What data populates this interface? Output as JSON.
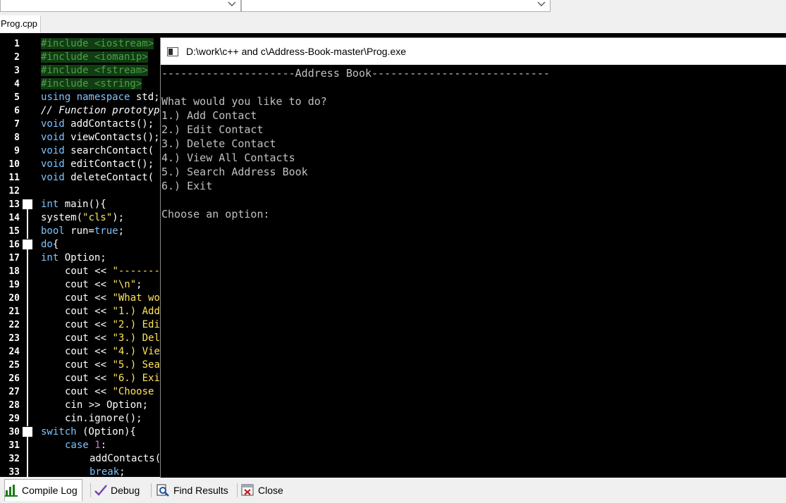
{
  "file_tab": {
    "label": "Prog.cpp"
  },
  "editor": {
    "line_numbers": [
      "1",
      "2",
      "3",
      "4",
      "5",
      "6",
      "7",
      "8",
      "9",
      "10",
      "11",
      "12",
      "13",
      "14",
      "15",
      "16",
      "17",
      "18",
      "19",
      "20",
      "21",
      "22",
      "23",
      "24",
      "25",
      "26",
      "27",
      "28",
      "29",
      "30",
      "31",
      "32",
      "33"
    ],
    "fold_lines": [
      "13",
      "16",
      "30"
    ]
  },
  "code": {
    "l1": "#include <iostream>",
    "l2": "#include <iomanip>",
    "l3": "#include <fstream>",
    "l4": "#include <string>",
    "l5_kw": "using namespace",
    "l5_rest": " std;",
    "l6": "// Function prototyp",
    "l7_kw": "void",
    "l7_rest": " addContacts();",
    "l8_kw": "void",
    "l8_rest": " viewContacts();",
    "l9_kw": "void",
    "l9_rest": " searchContact(",
    "l10_kw": "void",
    "l10_rest": " editContact();",
    "l11_kw": "void",
    "l11_rest": " deleteContact(",
    "l13_kw": "int",
    "l13_rest": " main(){",
    "l14_a": "system(",
    "l14_str": "\"cls\"",
    "l14_b": ");",
    "l15_kw": "bool",
    "l15_rest": " run=",
    "l15_kw2": "true",
    "l15_end": ";",
    "l16_kw": "do",
    "l16_rest": "{",
    "l17_kw": "int",
    "l17_rest": " Option;",
    "cout": "cout << ",
    "l18_str": "\"-------",
    "l19_str": "\"\\n\"",
    "l19_end": ";",
    "l20_str": "\"What wo",
    "l21_str": "\"1.) Add",
    "l22_str": "\"2.) Edi",
    "l23_str": "\"3.) Del",
    "l24_str": "\"4.) Vie",
    "l25_str": "\"5.) Sea",
    "l26_str": "\"6.) Exi",
    "l27_str": "\"Choose ",
    "l28": "cin >> Option;",
    "l29": "cin.ignore();",
    "l30_kw": "switch",
    "l30_rest": " (Option){",
    "l31_kw": "case",
    "l31_num": " 1",
    "l31_end": ":",
    "l32": "addContacts(",
    "l33_kw": "break",
    "l33_end": ";"
  },
  "console": {
    "title": "D:\\work\\c++ and c\\Address-Book-master\\Prog.exe",
    "lines": [
      "---------------------Address Book----------------------------",
      "",
      "What would you like to do?",
      "1.) Add Contact",
      "2.) Edit Contact",
      "3.) Delete Contact",
      "4.) View All Contacts",
      "5.) Search Address Book",
      "6.) Exit",
      "",
      "Choose an option:"
    ]
  },
  "bottom_tabs": {
    "compile_log": "Compile Log",
    "debug": "Debug",
    "find_results": "Find Results",
    "close": "Close"
  },
  "colors": {
    "editor_bg": "#000000",
    "preprocessor": "#4aa04a",
    "keyword": "#7ec3ff",
    "string": "#ffe45c",
    "number": "#d86adc",
    "console_text": "#c0c0c0"
  }
}
